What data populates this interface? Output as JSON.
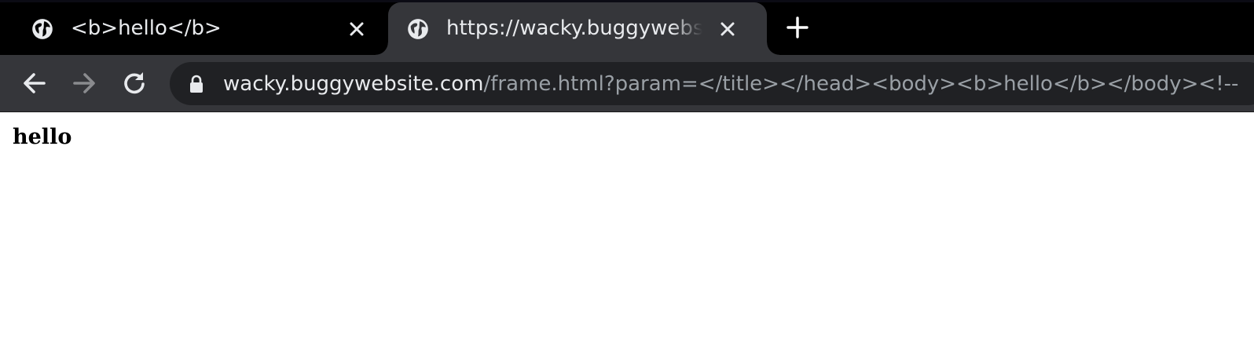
{
  "browser": {
    "tabs": [
      {
        "title": "<b>hello</b>",
        "favicon": "globe-icon",
        "active": false
      },
      {
        "title": "https://wacky.buggywebsite.com/frame.html?param=</title></head><body><b>hello</b></body><!--",
        "favicon": "globe-icon",
        "active": true
      }
    ],
    "new_tab_icon": "plus-icon",
    "toolbar": {
      "back_icon": "arrow-left-icon",
      "forward_icon": "arrow-right-icon",
      "reload_icon": "reload-icon",
      "security_icon": "lock-icon"
    },
    "address_bar": {
      "host": "wacky.buggywebsite.com",
      "path": "/frame.html?param=</title></head><body><b>hello</b></body><!--"
    }
  },
  "page": {
    "body_text": "hello"
  },
  "colors": {
    "tabstrip_bg": "#000000",
    "active_tab_bg": "#35363a",
    "omnibox_bg": "#202124",
    "host_text": "#e8eaed",
    "path_text": "#9aa0a6"
  }
}
